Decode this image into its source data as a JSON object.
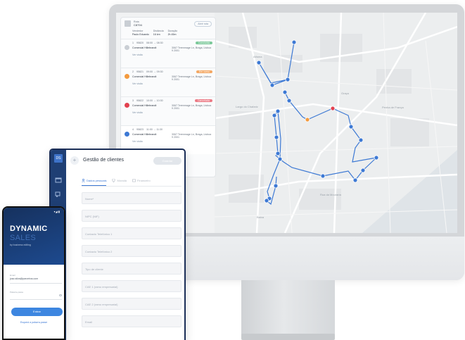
{
  "route_panel": {
    "route_label": "Rota",
    "route_id": "C8794",
    "route_chip": "Abrir rota",
    "meta": [
      {
        "label": "Vendedor",
        "value": "Paulo Eduardo"
      },
      {
        "label": "Distância",
        "value": "16 km"
      },
      {
        "label": "Duração",
        "value": "2h 45m"
      }
    ],
    "stops": [
      {
        "order": "1",
        "code": "95820",
        "time": "08:00 → 08:30",
        "status": "Concluída",
        "status_color": "#7cc99a",
        "name": "Comercial Hillebrandt",
        "address": "3067 Terenmage Ln, Braga, Lisboa 9 2001",
        "link": "Ver visita",
        "dot_color": "#c9ced4"
      },
      {
        "order": "2",
        "code": "95821",
        "time": "09:00 → 09:30",
        "status": "Em curso",
        "status_color": "#f4a864",
        "name": "Comercial Hillebrandt",
        "address": "3067 Terenmage Ln, Braga, Lisboa 9 2001",
        "link": "Ver visita",
        "dot_color": "#f39a3e"
      },
      {
        "order": "3",
        "code": "95822",
        "time": "10:00 → 10:30",
        "status": "Cancelada",
        "status_color": "#ec7b86",
        "name": "Comercial Hillebrandt",
        "address": "3067 Terenmage Ln, Braga, Lisboa 9 2001",
        "link": "Ver visita",
        "dot_color": "#e2414f"
      },
      {
        "order": "4",
        "code": "95823",
        "time": "11:00 → 11:30",
        "status": "",
        "status_color": "#ffffff",
        "name": "Comercial Hillebrandt",
        "address": "3067 Terenmage Ln, Braga, Lisboa 9 2001",
        "link": "Ver visita",
        "dot_color": "#3d79d4"
      }
    ]
  },
  "map": {
    "route_color": "#3d79d4",
    "start_color": "#f39a3e",
    "end_color": "#e2414f"
  },
  "tablet": {
    "logo": "DS",
    "title": "Gestão de clientes",
    "save_label": "Guardar",
    "tabs": [
      {
        "label": "Dados pessoais",
        "icon": "person-icon"
      },
      {
        "label": "Morada",
        "icon": "location-pin-icon"
      },
      {
        "label": "Financeiro",
        "icon": "card-icon"
      }
    ],
    "fields": [
      "Nome*",
      "NIPC (NIF)",
      "Contacto Telefónico 1",
      "Contacto Telefónico 2",
      "Tipo de cliente",
      "CAE 1 (ramo empresarial)",
      "CAE 2 (ramo empresarial)",
      "Email"
    ]
  },
  "phone": {
    "status": "▾◢ ▮",
    "brand_line1": "DYNAMIC",
    "brand_line2": "SALES",
    "tagline": "by business editing",
    "email_label": "Email",
    "email_value": "joao.silva@parceiros.com",
    "password_label": "Palavra-passe",
    "login_button": "Entrar",
    "forgot_link": "Esqueci a palavra-passe"
  }
}
